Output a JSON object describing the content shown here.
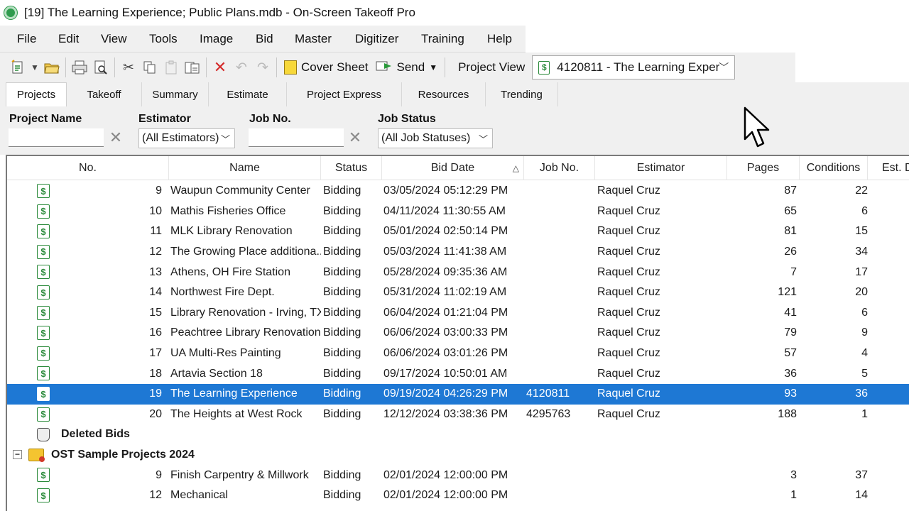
{
  "window": {
    "title": "[19] The Learning Experience; Public Plans.mdb - On-Screen Takeoff Pro"
  },
  "menu": [
    "File",
    "Edit",
    "View",
    "Tools",
    "Image",
    "Bid",
    "Master",
    "Digitizer",
    "Training",
    "Help"
  ],
  "toolbar": {
    "cover_sheet": "Cover Sheet",
    "send": "Send",
    "project_view_label": "Project View",
    "project_view_value": "4120811 - The Learning Exper"
  },
  "tabs": [
    "Projects",
    "Takeoff",
    "Summary",
    "Estimate",
    "Project Express",
    "Resources",
    "Trending"
  ],
  "filters": {
    "project_name_label": "Project Name",
    "project_name_value": "",
    "estimator_label": "Estimator",
    "estimator_value": "(All Estimators)",
    "job_no_label": "Job No.",
    "job_no_value": "",
    "job_status_label": "Job Status",
    "job_status_value": "(All Job Statuses)"
  },
  "columns": [
    "No.",
    "Name",
    "Status",
    "Bid Date",
    "Job No.",
    "Estimator",
    "Pages",
    "Conditions",
    "Est. D"
  ],
  "rows": [
    {
      "no": "9",
      "name": "Waupun Community Center",
      "status": "Bidding",
      "bid_date": "03/05/2024 05:12:29 PM",
      "job_no": "",
      "estimator": "Raquel Cruz",
      "pages": "87",
      "conditions": "22"
    },
    {
      "no": "10",
      "name": "Mathis Fisheries Office",
      "status": "Bidding",
      "bid_date": "04/11/2024 11:30:55 AM",
      "job_no": "",
      "estimator": "Raquel Cruz",
      "pages": "65",
      "conditions": "6"
    },
    {
      "no": "11",
      "name": "MLK Library Renovation",
      "status": "Bidding",
      "bid_date": "05/01/2024 02:50:14 PM",
      "job_no": "",
      "estimator": "Raquel Cruz",
      "pages": "81",
      "conditions": "15"
    },
    {
      "no": "12",
      "name": "The Growing Place additiona...",
      "status": "Bidding",
      "bid_date": "05/03/2024 11:41:38 AM",
      "job_no": "",
      "estimator": "Raquel Cruz",
      "pages": "26",
      "conditions": "34"
    },
    {
      "no": "13",
      "name": "Athens, OH Fire Station",
      "status": "Bidding",
      "bid_date": "05/28/2024 09:35:36 AM",
      "job_no": "",
      "estimator": "Raquel Cruz",
      "pages": "7",
      "conditions": "17"
    },
    {
      "no": "14",
      "name": "Northwest Fire Dept.",
      "status": "Bidding",
      "bid_date": "05/31/2024 11:02:19 AM",
      "job_no": "",
      "estimator": "Raquel Cruz",
      "pages": "121",
      "conditions": "20"
    },
    {
      "no": "15",
      "name": "Library Renovation - Irving, TX",
      "status": "Bidding",
      "bid_date": "06/04/2024 01:21:04 PM",
      "job_no": "",
      "estimator": "Raquel Cruz",
      "pages": "41",
      "conditions": "6"
    },
    {
      "no": "16",
      "name": "Peachtree Library Renovation",
      "status": "Bidding",
      "bid_date": "06/06/2024 03:00:33 PM",
      "job_no": "",
      "estimator": "Raquel Cruz",
      "pages": "79",
      "conditions": "9"
    },
    {
      "no": "17",
      "name": "UA Multi-Res Painting",
      "status": "Bidding",
      "bid_date": "06/06/2024 03:01:26 PM",
      "job_no": "",
      "estimator": "Raquel Cruz",
      "pages": "57",
      "conditions": "4"
    },
    {
      "no": "18",
      "name": "Artavia Section 18",
      "status": "Bidding",
      "bid_date": "09/17/2024 10:50:01 AM",
      "job_no": "",
      "estimator": "Raquel Cruz",
      "pages": "36",
      "conditions": "5"
    },
    {
      "no": "19",
      "name": "The Learning Experience",
      "status": "Bidding",
      "bid_date": "09/19/2024 04:26:29 PM",
      "job_no": "4120811",
      "estimator": "Raquel Cruz",
      "pages": "93",
      "conditions": "36",
      "selected": true
    },
    {
      "no": "20",
      "name": "The Heights at West Rock",
      "status": "Bidding",
      "bid_date": "12/12/2024 03:38:36 PM",
      "job_no": "4295763",
      "estimator": "Raquel Cruz",
      "pages": "188",
      "conditions": "1"
    }
  ],
  "groups": {
    "deleted_bids": "Deleted Bids",
    "sample_projects": "OST Sample Projects 2024",
    "expander_symbol": "−"
  },
  "sample_rows": [
    {
      "no": "9",
      "name": "Finish Carpentry & Millwork",
      "status": "Bidding",
      "bid_date": "02/01/2024 12:00:00 PM",
      "job_no": "",
      "estimator": "",
      "pages": "3",
      "conditions": "37"
    },
    {
      "no": "12",
      "name": "Mechanical",
      "status": "Bidding",
      "bid_date": "02/01/2024 12:00:00 PM",
      "job_no": "",
      "estimator": "",
      "pages": "1",
      "conditions": "14"
    }
  ],
  "colors": {
    "selection": "#1e78d4",
    "accent_green": "#2a8a3a"
  }
}
